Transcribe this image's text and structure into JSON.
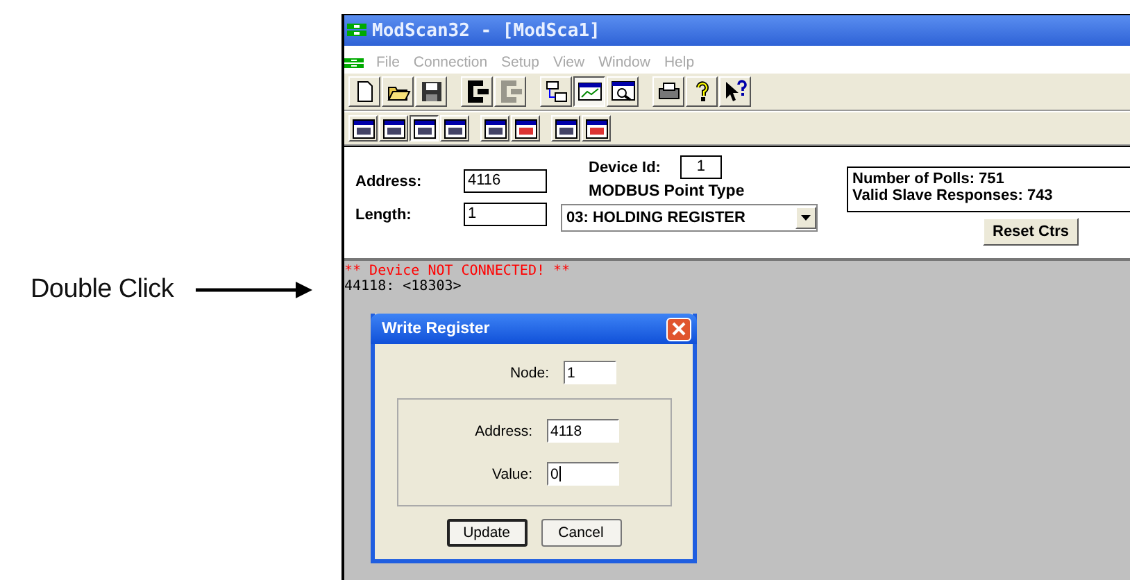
{
  "annotation": {
    "label": "Double Click"
  },
  "window": {
    "title": "ModScan32 - [ModSca1]"
  },
  "menu": [
    {
      "label": "File",
      "disabled": true
    },
    {
      "label": "Connection",
      "disabled": true
    },
    {
      "label": "Setup",
      "disabled": true
    },
    {
      "label": "View",
      "disabled": true
    },
    {
      "label": "Window",
      "disabled": true
    },
    {
      "label": "Help",
      "disabled": true
    }
  ],
  "toolbar": [
    [
      {
        "kind": "new",
        "pressed": false,
        "disabled": false
      },
      {
        "kind": "open",
        "pressed": false,
        "disabled": false
      },
      {
        "kind": "save",
        "pressed": false,
        "disabled": false
      }
    ],
    [
      {
        "kind": "connect",
        "pressed": false,
        "disabled": false
      },
      {
        "kind": "disconnect",
        "pressed": false,
        "disabled": true
      }
    ],
    [
      {
        "kind": "tree",
        "pressed": false,
        "disabled": false
      },
      {
        "kind": "chart",
        "pressed": true,
        "disabled": false
      },
      {
        "kind": "find",
        "pressed": false,
        "disabled": false
      }
    ],
    [
      {
        "kind": "print",
        "pressed": false,
        "disabled": false
      },
      {
        "kind": "help",
        "pressed": false,
        "disabled": false
      },
      {
        "kind": "whatsthis",
        "pressed": false,
        "disabled": false
      }
    ]
  ],
  "format_toolbar": [
    [
      {
        "kind": "plain",
        "pressed": false
      },
      {
        "kind": "plain",
        "pressed": false
      },
      {
        "kind": "plain",
        "pressed": true
      },
      {
        "kind": "plain",
        "pressed": false
      }
    ],
    [
      {
        "kind": "plain",
        "pressed": false
      },
      {
        "kind": "red",
        "pressed": false
      }
    ],
    [
      {
        "kind": "plain",
        "pressed": false
      },
      {
        "kind": "red",
        "pressed": false
      }
    ]
  ],
  "form": {
    "address_label": "Address:",
    "address": "4116",
    "length_label": "Length:",
    "length": "1",
    "device_id_label": "Device Id:",
    "device_id": "1",
    "point_type_label": "MODBUS Point Type",
    "point_type": "03: HOLDING REGISTER",
    "stats": [
      "Number of Polls: 751",
      "Valid Slave Responses: 743"
    ],
    "reset_button": "Reset Ctrs"
  },
  "output": [
    {
      "text": "** Device NOT CONNECTED! **",
      "kind": "error"
    },
    {
      "text": "44118: <18303>",
      "kind": "value"
    }
  ],
  "dialog": {
    "title": "Write Register",
    "node_label": "Node:",
    "node": "1",
    "address_label": "Address:",
    "address": "4118",
    "value_label": "Value:",
    "value": "0",
    "buttons": [
      {
        "label": "Update",
        "default": true
      },
      {
        "label": "Cancel",
        "default": false
      }
    ]
  }
}
